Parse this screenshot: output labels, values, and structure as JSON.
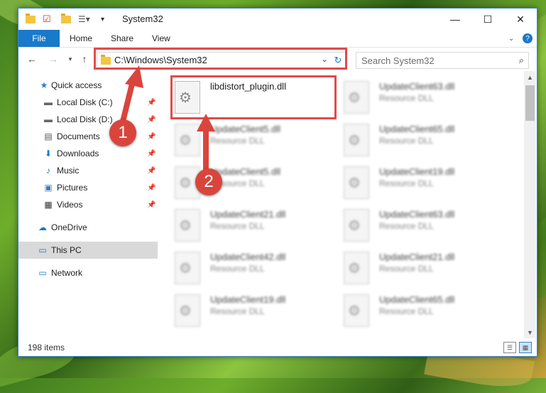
{
  "window": {
    "title": "System32",
    "controls": {
      "minimize": "—",
      "maximize": "☐",
      "close": "✕"
    }
  },
  "ribbon": {
    "file_tab": "File",
    "tabs": [
      "Home",
      "Share",
      "View"
    ],
    "help": "?"
  },
  "navigation": {
    "address": "C:\\Windows\\System32",
    "search_placeholder": "Search System32"
  },
  "sidebar": {
    "items": [
      {
        "label": "Quick access",
        "icon": "star-icon"
      },
      {
        "label": "Local Disk (C:)",
        "icon": "drive-icon",
        "pinned": true
      },
      {
        "label": "Local Disk (D:)",
        "icon": "drive-icon",
        "pinned": true
      },
      {
        "label": "Documents",
        "icon": "document-icon",
        "pinned": true
      },
      {
        "label": "Downloads",
        "icon": "download-icon",
        "pinned": true
      },
      {
        "label": "Music",
        "icon": "music-icon",
        "pinned": true
      },
      {
        "label": "Pictures",
        "icon": "picture-icon",
        "pinned": true
      },
      {
        "label": "Videos",
        "icon": "video-icon",
        "pinned": true
      },
      {
        "label": "OneDrive",
        "icon": "cloud-icon"
      },
      {
        "label": "This PC",
        "icon": "computer-icon",
        "selected": true
      },
      {
        "label": "Network",
        "icon": "network-icon"
      }
    ]
  },
  "files": [
    {
      "name": "libdistort_plugin.dll",
      "type": ""
    },
    {
      "name": "UpdateClient63.dll",
      "type": "Resource DLL"
    },
    {
      "name": "UpdateClient5.dll",
      "type": "Resource DLL"
    },
    {
      "name": "UpdateClient65.dll",
      "type": "Resource DLL"
    },
    {
      "name": "UpdateClient5.dll",
      "type": "Resource DLL"
    },
    {
      "name": "UpdateClient19.dll",
      "type": "Resource DLL"
    },
    {
      "name": "UpdateClient21.dll",
      "type": "Resource DLL"
    },
    {
      "name": "UpdateClient63.dll",
      "type": "Resource DLL"
    },
    {
      "name": "UpdateClient42.dll",
      "type": "Resource DLL"
    },
    {
      "name": "UpdateClient21.dll",
      "type": "Resource DLL"
    },
    {
      "name": "UpdateClient19.dll",
      "type": "Resource DLL"
    },
    {
      "name": "UpdateClient65.dll",
      "type": "Resource DLL"
    }
  ],
  "status": {
    "item_count": "198 items"
  },
  "callouts": {
    "one": "1",
    "two": "2"
  },
  "colors": {
    "accent": "#1979ca",
    "highlight": "#e04b4b",
    "badge": "#d9453c"
  }
}
